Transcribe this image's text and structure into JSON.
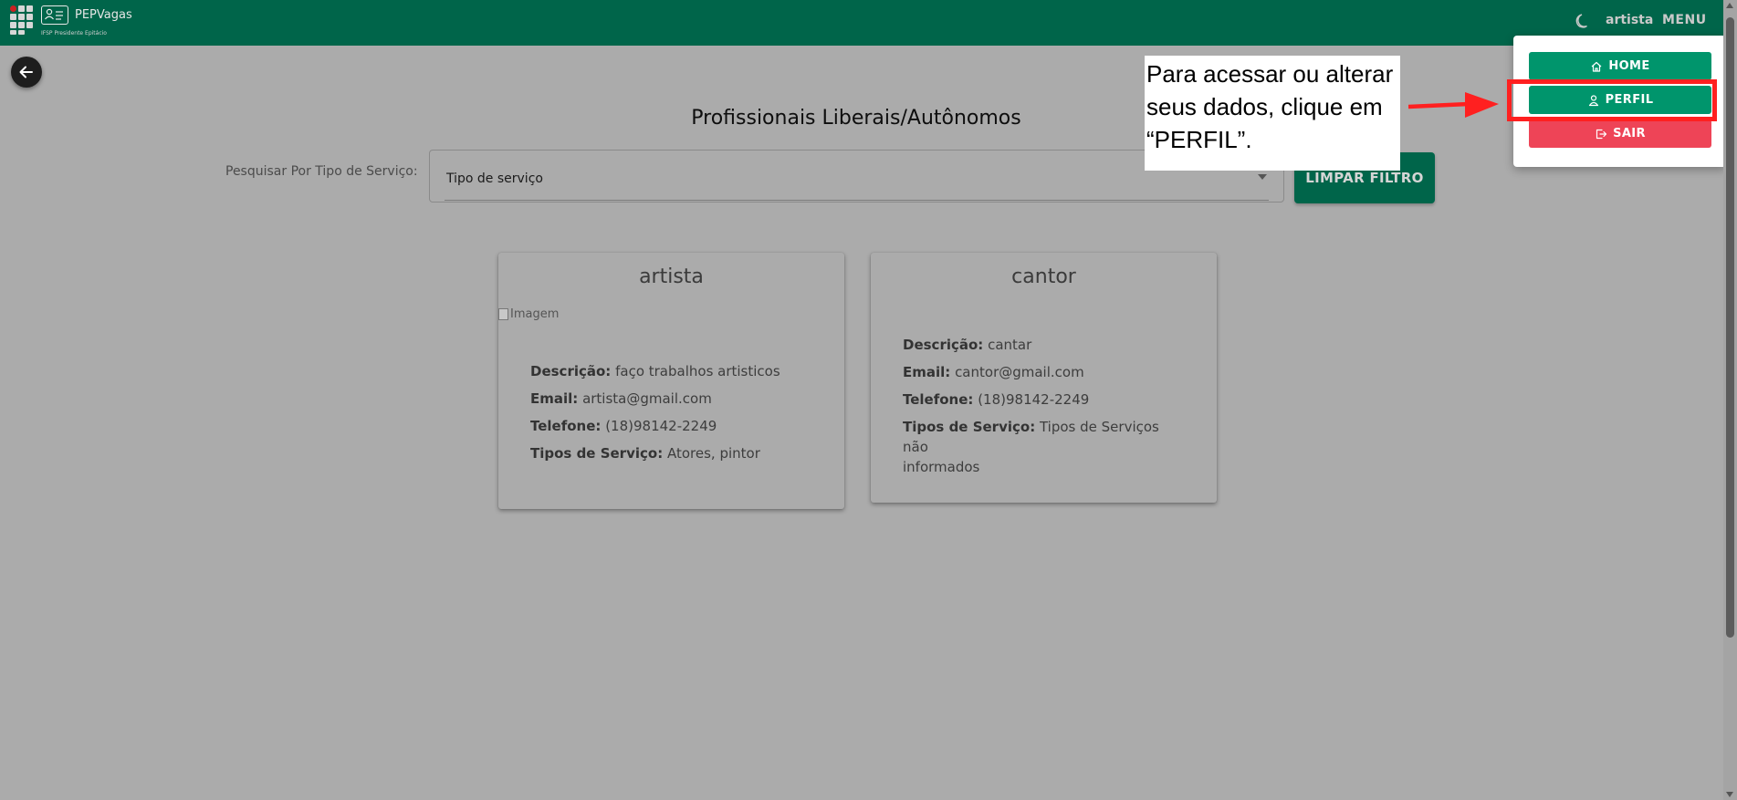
{
  "header": {
    "app_name": "PEPVagas",
    "app_subtitle": "IFSP Presidente Epitácio",
    "user": "artista",
    "menu_label": "MENU",
    "background": "#00654a"
  },
  "main": {
    "title": "Profissionais Liberais/Autônomos",
    "search_label": "Pesquisar Por Tipo de Serviço:",
    "select_value": "Tipo de serviço",
    "clear_button": "LIMPAR FILTRO"
  },
  "cards": [
    {
      "name": "artista",
      "image_alt": "Imagem",
      "descricao_label": "Descrição:",
      "descricao": "faço trabalhos artisticos",
      "email_label": "Email:",
      "email": "artista@gmail.com",
      "telefone_label": "Telefone:",
      "telefone": "(18)98142-2249",
      "tipos_label": "Tipos de Serviço:",
      "tipos": "Atores, pintor"
    },
    {
      "name": "cantor",
      "descricao_label": "Descrição:",
      "descricao": "cantar",
      "email_label": "Email:",
      "email": "cantor@gmail.com",
      "telefone_label": "Telefone:",
      "telefone": "(18)98142-2249",
      "tipos_label": "Tipos de Serviço:",
      "tipos_line1": "Tipos de Serviços não",
      "tipos_line2": "informados"
    }
  ],
  "menu_dropdown": {
    "home": "HOME",
    "perfil": "PERFIL",
    "sair": "SAIR",
    "primary_color": "#00956c",
    "danger_color": "#ee4457"
  },
  "annotation": {
    "line1": "Para acessar ou alterar",
    "line2": "seus dados, clique em",
    "line3": "“PERFIL”.",
    "highlight_color": "#ff2020"
  }
}
